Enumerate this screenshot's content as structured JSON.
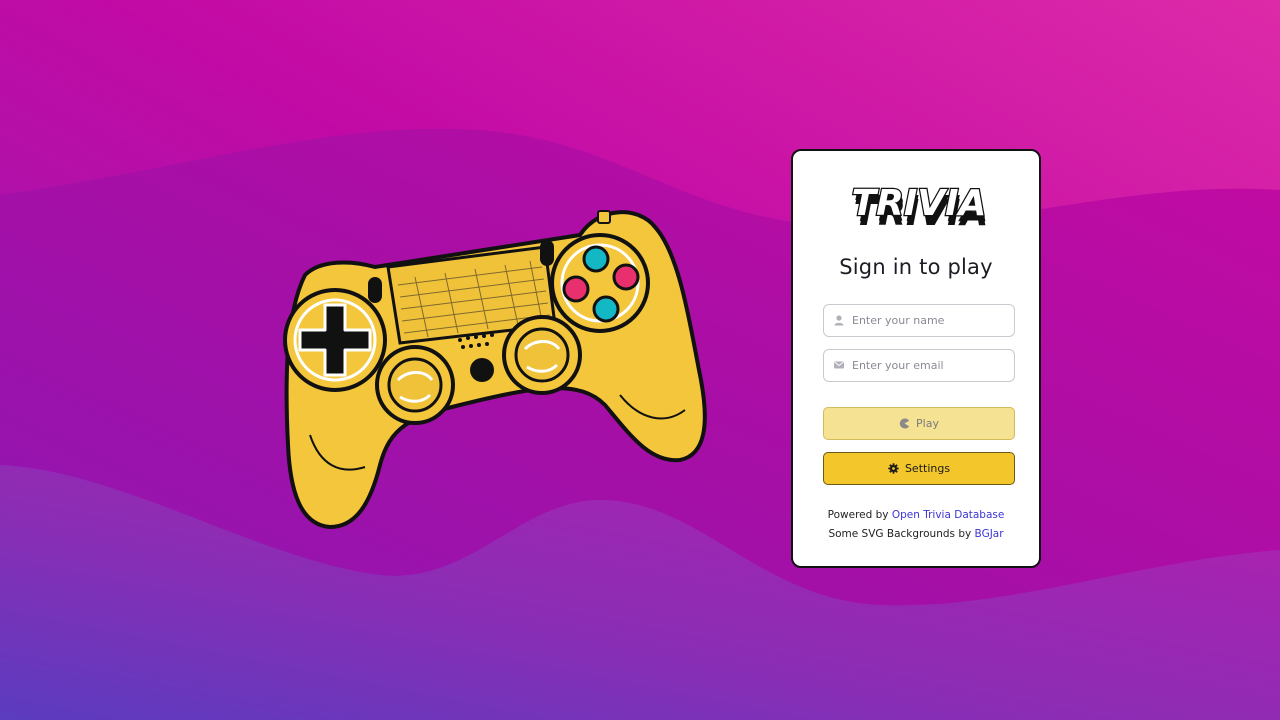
{
  "app": {
    "logo_text": "TRIVIA"
  },
  "signin": {
    "title": "Sign in to play",
    "name_placeholder": "Enter your name",
    "email_placeholder": "Enter your email",
    "play_label": "Play",
    "settings_label": "Settings"
  },
  "credits": {
    "powered_prefix": "Powered by",
    "powered_link": "Open Trivia Database",
    "backgrounds_prefix": "Some SVG Backgrounds by",
    "backgrounds_link": "BGJar"
  },
  "icons": {
    "name_field": "user-icon",
    "email_field": "envelope-icon",
    "play_button": "pacman-icon",
    "settings_button": "gear-icon",
    "illustration": "gamepad-controller"
  },
  "colors": {
    "background_top": "#d10aa0",
    "background_mid": "#a513a8",
    "background_bottom": "#5a3dbd",
    "controller_body": "#f3c63c",
    "play_button_bg": "#f6e293",
    "settings_button_bg": "#f3c62c",
    "link": "#3a35d6",
    "button_cyan": "#14b8c4",
    "button_pink": "#e8306e"
  }
}
